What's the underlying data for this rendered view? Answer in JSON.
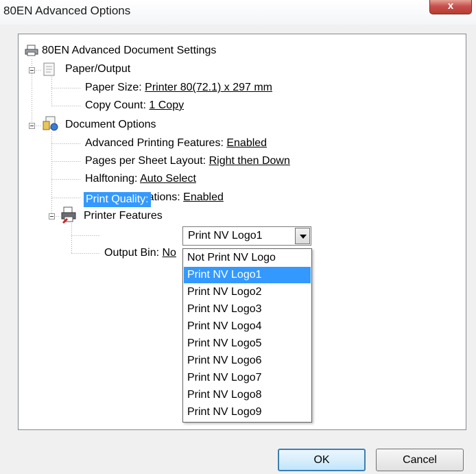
{
  "window": {
    "title": "80EN Advanced Options",
    "close_glyph": "x"
  },
  "tree": {
    "root_label": "80EN Advanced Document Settings",
    "paper_output": {
      "label": "Paper/Output",
      "paper_size_label": "Paper Size: ",
      "paper_size_value": "Printer 80(72.1) x 297 mm",
      "copy_count_label": "Copy Count: ",
      "copy_count_value": "1 Copy"
    },
    "document_options": {
      "label": "Document Options",
      "advanced_printing_label": "Advanced Printing Features: ",
      "advanced_printing_value": "Enabled",
      "pages_per_sheet_label": "Pages per Sheet Layout: ",
      "pages_per_sheet_value": "Right then Down",
      "halftoning_label": "Halftoning: ",
      "halftoning_value": "Auto Select",
      "print_optimizations_label": "Print Optimizations: ",
      "print_optimizations_value": "Enabled"
    },
    "printer_features": {
      "label": "Printer Features",
      "print_quality_label": "Print Quality:",
      "print_quality_value": "Print NV Logo1",
      "output_bin_label": "Output Bin: ",
      "output_bin_value_visible": "No"
    }
  },
  "dropdown": {
    "options": [
      "Not Print NV Logo",
      "Print NV Logo1",
      "Print NV Logo2",
      "Print NV Logo3",
      "Print NV Logo4",
      "Print NV Logo5",
      "Print NV Logo6",
      "Print NV Logo7",
      "Print NV Logo8",
      "Print NV Logo9"
    ],
    "selected_index": 1
  },
  "buttons": {
    "ok_label": "OK",
    "cancel_label": "Cancel"
  },
  "colors": {
    "selection": "#3399ff",
    "close": "#c75050",
    "default_button_border": "#3c7fb1"
  },
  "icons": {
    "root": "printer-icon",
    "paper_output": "paper-icon",
    "document_options": "document-options-icon",
    "printer_features": "printer-features-icon"
  }
}
